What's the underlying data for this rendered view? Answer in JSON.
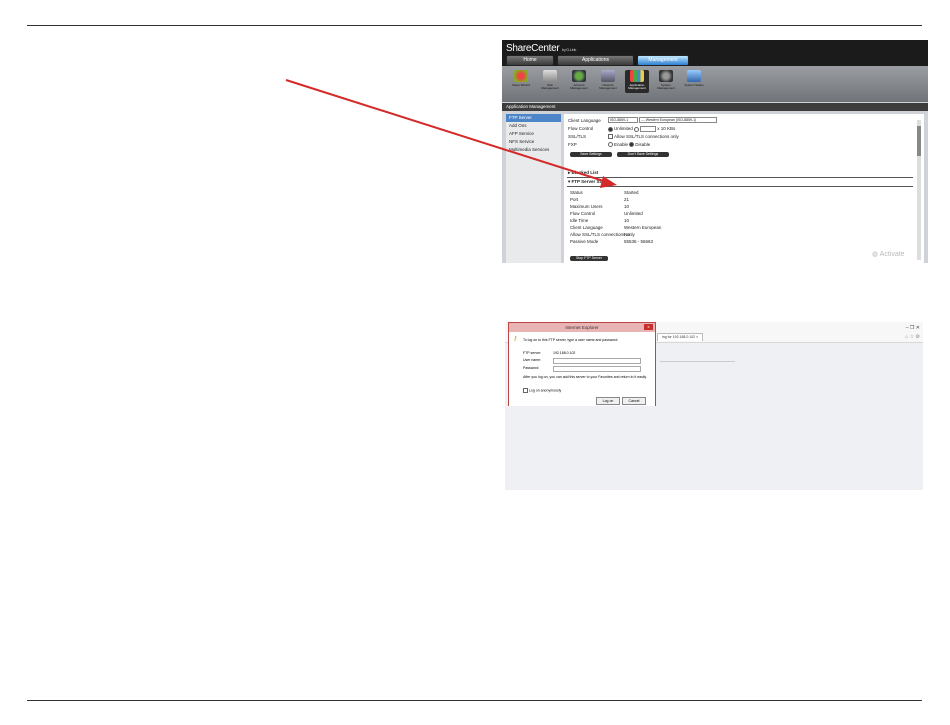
{
  "sharecenter": {
    "brand": "ShareCenter",
    "brand_sub": "by D-Link",
    "tabs": [
      "Home",
      "Applications",
      "Management"
    ],
    "toolbar": [
      "Setup Wizard",
      "Disk Management",
      "Account Management",
      "Network Management",
      "Application Management",
      "System Management",
      "System Status"
    ],
    "strip_title": "Application Management",
    "sidebar": [
      "FTP Server",
      "Add Ons",
      "AFP Service",
      "NFS Service",
      "Multimedia Services"
    ],
    "client_language_label": "Client Language",
    "client_language_value": "ISO-8859-1",
    "client_language_desc": "--- Western European (ISO-8859-1)",
    "flow_control_label": "Flow Control",
    "flow_control_unlimited": "Unlimited",
    "flow_control_unit": "x 10 KBs",
    "ssl_label": "SSL/TLS",
    "ssl_option": "Allow SSL/TLS connections only",
    "fxp_label": "FXP",
    "fxp_enable": "Enable",
    "fxp_disable": "Disable",
    "btn_save": "Save Settings",
    "btn_dont_save": "Don't Save Settings",
    "blocked_list": "Blocked List",
    "status_section": "FTP Server Status",
    "status_rows": [
      [
        "Status",
        "Started"
      ],
      [
        "Port",
        "21"
      ],
      [
        "Maximum Users",
        "10"
      ],
      [
        "Flow Control",
        "Unlimited"
      ],
      [
        "Idle Time",
        "10"
      ],
      [
        "Client Language",
        "Western European"
      ],
      [
        "Allow SSL/TLS connections only",
        "No"
      ],
      [
        "Passive Mode",
        "55536 - 55663"
      ]
    ],
    "btn_stop": "Stop FTP Server",
    "watermark": "Activate"
  },
  "ie": {
    "title": "Internet Explorer",
    "close": "x",
    "prompt": "To log on to this FTP server, type a user name and password.",
    "server_label": "FTP server:",
    "server_value": "192.168.0.102",
    "user_label": "User name:",
    "password_label": "Password:",
    "note": "After you log on, you can add this server to your Favorites and return to it easily.",
    "anon": "Log on anonymously",
    "btn_logon": "Log on",
    "btn_cancel": "Cancel",
    "tab_label": "ing for 192.168.0.102",
    "tab_close": "×",
    "win_controls": "–  ❐  ✕",
    "win_icons": "⌂ ☆ ⚙"
  },
  "colors": {
    "arrow": "#d42a2a",
    "active_tab": "#2e7fd0",
    "selected": "#4d85c9"
  }
}
